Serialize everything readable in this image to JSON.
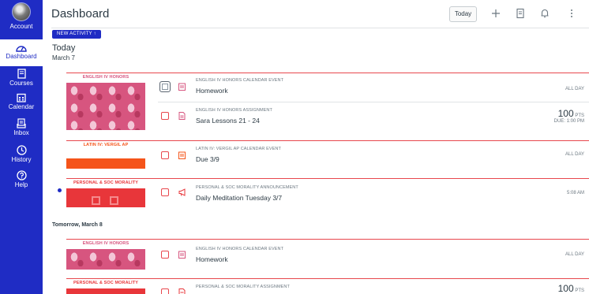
{
  "nav": {
    "account": "Account",
    "dashboard": "Dashboard",
    "courses": "Courses",
    "calendar": "Calendar",
    "inbox": "Inbox",
    "history": "History",
    "help": "Help"
  },
  "header": {
    "title": "Dashboard",
    "today_button": "Today"
  },
  "new_activity": "NEW ACTIVITY ↑",
  "days": [
    {
      "title": "Today",
      "date": "March 7"
    },
    {
      "title": "Tomorrow, March 8"
    }
  ],
  "groups": [
    {
      "course": "ENGLISH IV HONORS",
      "color": "#d7557f",
      "items": [
        {
          "kind": "ENGLISH IV HONORS CALENDAR EVENT",
          "title": "Homework",
          "right": "ALL DAY",
          "icon": "calendar-icon"
        },
        {
          "kind": "ENGLISH IV HONORS ASSIGNMENT",
          "title": "Sara Lessons 21 - 24",
          "points": "100",
          "points_unit": "PTS",
          "due": "DUE: 1:00 PM",
          "icon": "assignment-icon"
        }
      ]
    },
    {
      "course": "LATIN IV: VERGIL AP",
      "color": "#f5541a",
      "items": [
        {
          "kind": "LATIN IV: VERGIL AP CALENDAR EVENT",
          "title": "Due 3/9",
          "right": "ALL DAY",
          "icon": "calendar-icon"
        }
      ]
    },
    {
      "course": "PERSONAL & SOC MORALITY",
      "color": "#e8363a",
      "items": [
        {
          "kind": "PERSONAL & SOC MORALITY ANNOUNCEMENT",
          "title": "Daily Meditation Tuesday 3/7",
          "right": "5:08 AM",
          "icon": "announcement-icon"
        }
      ]
    },
    {
      "course": "ENGLISH IV HONORS",
      "color": "#d7557f",
      "items": [
        {
          "kind": "ENGLISH IV HONORS CALENDAR EVENT",
          "title": "Homework",
          "right": "ALL DAY",
          "icon": "calendar-icon"
        }
      ]
    },
    {
      "course": "PERSONAL & SOC MORALITY",
      "color": "#e8363a",
      "items": [
        {
          "kind": "PERSONAL & SOC MORALITY ASSIGNMENT",
          "points": "100",
          "points_unit": "PTS",
          "icon": "assignment-icon"
        }
      ]
    }
  ]
}
